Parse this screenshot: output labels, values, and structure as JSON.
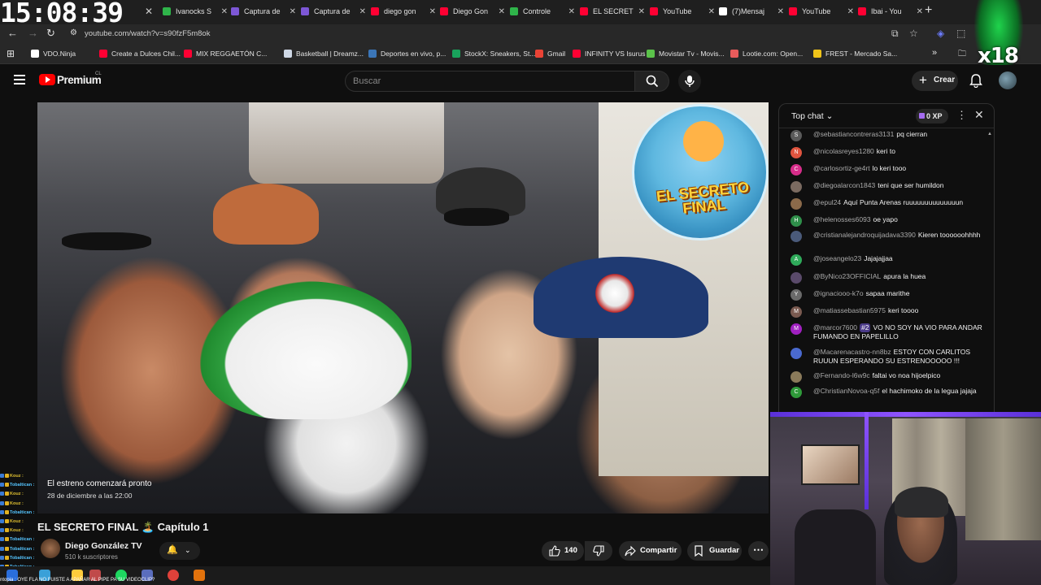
{
  "clock": "15:08:39",
  "tabs": [
    {
      "label": "Ivanocks S",
      "color": "#2fb44a"
    },
    {
      "label": "Captura de",
      "color": "#7d57d6"
    },
    {
      "label": "Captura de",
      "color": "#7d57d6"
    },
    {
      "label": "diego gon",
      "color": "#ff0033"
    },
    {
      "label": "Diego Gon",
      "color": "#ff0033"
    },
    {
      "label": "Controle",
      "color": "#2fb44a"
    },
    {
      "label": "EL SECRET",
      "color": "#ff0033"
    },
    {
      "label": "YouTube",
      "color": "#ff0033"
    },
    {
      "label": "(7)Mensaj",
      "color": "#ffffff"
    },
    {
      "label": "YouTube",
      "color": "#ff0033"
    },
    {
      "label": "Ibai - You",
      "color": "#ff0033"
    }
  ],
  "address": {
    "url": "youtube.com/watch?v=s90fzF5m8ok"
  },
  "bookmarks": [
    {
      "label": "VDO.Ninja",
      "color": "#ffffff"
    },
    {
      "label": "Create a Dulces Chil...",
      "color": "#ff0033"
    },
    {
      "label": "MIX REGGAETÓN C...",
      "color": "#ff0033"
    },
    {
      "label": "Basketball | Dreamz...",
      "color": "#cfd8e6"
    },
    {
      "label": "Deportes en vivo, p...",
      "color": "#3b76b8"
    },
    {
      "label": "StockX: Sneakers, St...",
      "color": "#19a35c"
    },
    {
      "label": "Gmail",
      "color": "#ea4335"
    },
    {
      "label": "INFINITY VS Isurus",
      "color": "#ff0033"
    },
    {
      "label": "Movistar Tv - Movis...",
      "color": "#5bc24a"
    },
    {
      "label": "Lootie.com: Open...",
      "color": "#e85b5b"
    },
    {
      "label": "FREST - Mercado Sa...",
      "color": "#f0c419"
    }
  ],
  "bookmarks_more": "»",
  "yt": {
    "brand": "Premium",
    "region": "CL",
    "search_placeholder": "Buscar",
    "create_label": "Crear"
  },
  "video": {
    "promo_text": "EL SECRETO FINAL",
    "premiere_title": "El estreno comenzará pronto",
    "premiere_date": "28 de diciembre a las 22:00",
    "title": "EL SECRETO FINAL 🏝️ Capítulo 1",
    "channel": "Diego González TV",
    "subscribers": "510 k suscriptores",
    "likes": "140",
    "share_label": "Compartir",
    "save_label": "Guardar"
  },
  "chat": {
    "mode": "Top chat",
    "xp": "0 XP",
    "messages": [
      {
        "author": "@sebastiancontreras3131",
        "text": "pq cierran",
        "avatar": "S",
        "color": "#5a5a5a"
      },
      {
        "author": "@nicolasreyes1280",
        "text": "keri to",
        "avatar": "N",
        "color": "#e0543f"
      },
      {
        "author": "@carlosortiz-ge4rt",
        "text": "lo keri tooo",
        "avatar": "C",
        "color": "#d62d8a"
      },
      {
        "author": "@diegoalarcon1843",
        "text": "teni que ser humildon",
        "avatar": "",
        "color": "#7a6a60"
      },
      {
        "author": "@epul24",
        "text": "Aquí Punta Arenas ruuuuuuuuuuuuuun",
        "avatar": "",
        "color": "#8b6a4a"
      },
      {
        "author": "@helenosses6093",
        "text": "oe yapo",
        "avatar": "H",
        "color": "#2f8f4a"
      },
      {
        "author": "@cristianalejandroquijadava3390",
        "text": "Kieren toooooohhhh",
        "avatar": "",
        "color": "#4a5a7a"
      },
      {
        "author": "@joseangelo23",
        "text": "Jajajajjaa",
        "avatar": "A",
        "color": "#2faa5a"
      },
      {
        "author": "@ByNico23OFFICIAL",
        "text": "apura la huea",
        "avatar": "",
        "color": "#5a4a6a"
      },
      {
        "author": "@ignaciooo-k7o",
        "text": "sapaa marithe",
        "avatar": "Y",
        "color": "#6a6a6a"
      },
      {
        "author": "@matiassebastian5975",
        "text": "keri toooo",
        "avatar": "M",
        "color": "#7a5a50"
      },
      {
        "author": "@marcor7600",
        "badge": "#2",
        "text": "VO NO SOY NA VIO PARA ANDAR FUMANDO EN PAPELILLO",
        "avatar": "M",
        "color": "#a020c0"
      },
      {
        "author": "@Macarenacastro-nn8bz",
        "text": "ESTOY CON CARLITOS RUUUN ESPERANDO SU ESTRENOOOOO !!!",
        "avatar": "",
        "color": "#4a6ad0"
      },
      {
        "author": "@Fernando-l6w9c",
        "text": "faltai vo noa hijoelpico",
        "avatar": "",
        "color": "#8a7a5a"
      },
      {
        "author": "@ChristianNovoa-q5f",
        "text": "el hachimoko de la legua jajaja",
        "avatar": "C",
        "color": "#2f9a3a"
      }
    ]
  },
  "overlay_chat": [
    {
      "user": "Kouz :",
      "color": "#e0c030"
    },
    {
      "user": "Tobaltican :",
      "color": "#55c5ff"
    },
    {
      "user": "Kouz :",
      "color": "#e0c030"
    },
    {
      "user": "Kouz :",
      "color": "#e0c030"
    },
    {
      "user": "Tobaltican :",
      "color": "#55c5ff"
    },
    {
      "user": "Kouz :",
      "color": "#e0c030"
    },
    {
      "user": "Kouz :",
      "color": "#e0c030"
    },
    {
      "user": "Tobaltican :",
      "color": "#55c5ff"
    },
    {
      "user": "Tobaltican :",
      "color": "#55c5ff"
    },
    {
      "user": "Tobaltican :",
      "color": "#55c5ff"
    },
    {
      "user": "Tobaltican :",
      "color": "#55c5ff"
    }
  ],
  "overlay_last": "fasdjklsjadfkasd",
  "bottom_caption": "ntopia : OYE FLA NO FUISTE A APAÑAR AL PIPE PA SU VIDEOCLIP?",
  "badge_x18": "x18"
}
